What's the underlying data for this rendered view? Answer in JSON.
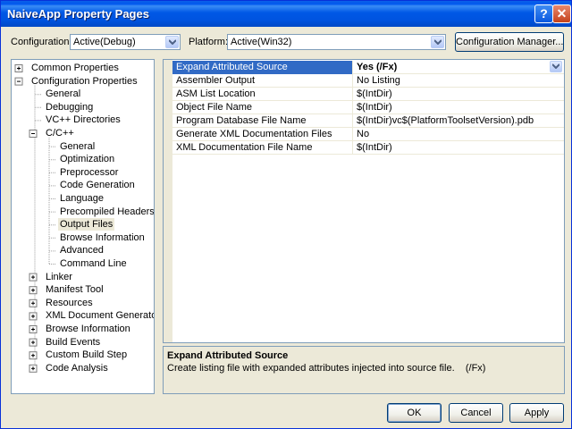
{
  "window": {
    "title": "NaiveApp Property Pages",
    "help_glyph": "?",
    "close_glyph": "✕"
  },
  "toolbar": {
    "configuration_label": "Configuration:",
    "configuration_value": "Active(Debug)",
    "platform_label": "Platform:",
    "platform_value": "Active(Win32)",
    "configuration_manager_label": "Configuration Manager..."
  },
  "tree": {
    "nodes": [
      {
        "label": "Common Properties",
        "expander": "plus"
      },
      {
        "label": "Configuration Properties",
        "expander": "minus"
      },
      {
        "label": "General"
      },
      {
        "label": "Debugging"
      },
      {
        "label": "VC++ Directories"
      },
      {
        "label": "C/C++",
        "expander": "minus"
      },
      {
        "label": "General"
      },
      {
        "label": "Optimization"
      },
      {
        "label": "Preprocessor"
      },
      {
        "label": "Code Generation"
      },
      {
        "label": "Language"
      },
      {
        "label": "Precompiled Headers"
      },
      {
        "label": "Output Files",
        "selected": true
      },
      {
        "label": "Browse Information"
      },
      {
        "label": "Advanced"
      },
      {
        "label": "Command Line"
      },
      {
        "label": "Linker",
        "expander": "plus"
      },
      {
        "label": "Manifest Tool",
        "expander": "plus"
      },
      {
        "label": "Resources",
        "expander": "plus"
      },
      {
        "label": "XML Document Generator",
        "expander": "plus"
      },
      {
        "label": "Browse Information",
        "expander": "plus"
      },
      {
        "label": "Build Events",
        "expander": "plus"
      },
      {
        "label": "Custom Build Step",
        "expander": "plus"
      },
      {
        "label": "Code Analysis",
        "expander": "plus"
      }
    ]
  },
  "properties": {
    "rows": [
      {
        "name": "Expand Attributed Source",
        "value": "Yes (/Fx)",
        "selected": true
      },
      {
        "name": "Assembler Output",
        "value": "No Listing"
      },
      {
        "name": "ASM List Location",
        "value": "$(IntDir)"
      },
      {
        "name": "Object File Name",
        "value": "$(IntDir)"
      },
      {
        "name": "Program Database File Name",
        "value": "$(IntDir)vc$(PlatformToolsetVersion).pdb"
      },
      {
        "name": "Generate XML Documentation Files",
        "value": "No"
      },
      {
        "name": "XML Documentation File Name",
        "value": "$(IntDir)"
      }
    ]
  },
  "description": {
    "title": "Expand Attributed Source",
    "text": "Create listing file with expanded attributes injected into source file.",
    "switch": "(/Fx)"
  },
  "footer": {
    "ok_label": "OK",
    "cancel_label": "Cancel",
    "apply_label": "Apply"
  },
  "colors": {
    "titlebar": "#0058e6",
    "selection": "#316ac5",
    "dialog_bg": "#ece9d8"
  },
  "icons": {
    "help": "help-icon",
    "close": "close-icon",
    "dropdown": "chevron-down-icon",
    "expand": "plus-box-icon",
    "collapse": "minus-box-icon"
  }
}
